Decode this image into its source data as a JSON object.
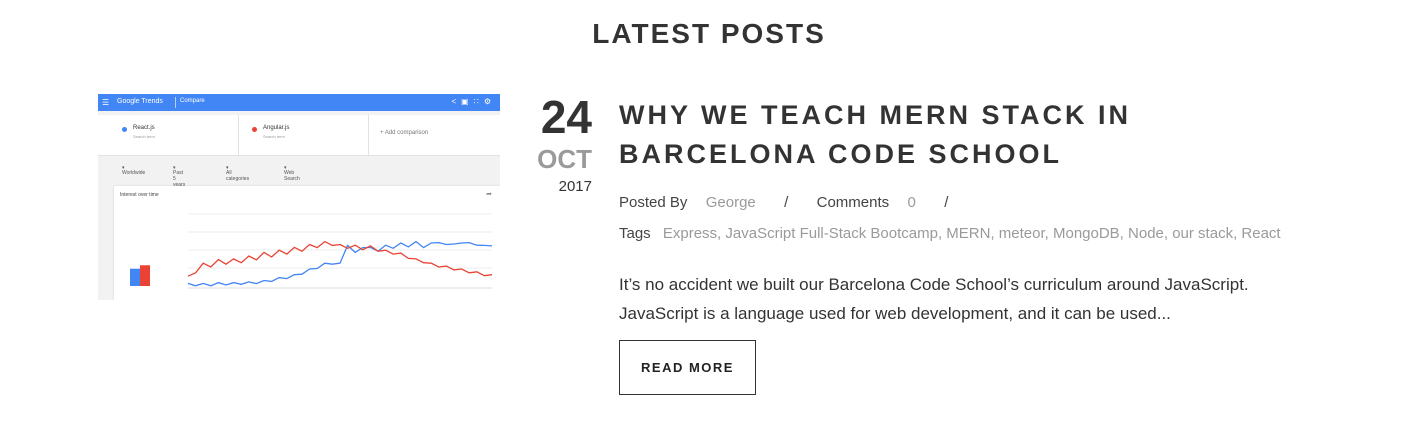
{
  "section": {
    "title": "LATEST POSTS"
  },
  "post": {
    "date": {
      "day": "24",
      "month": "OCT",
      "year": "2017"
    },
    "title": "WHY WE TEACH MERN STACK IN BARCELONA CODE SCHOOL",
    "meta": {
      "posted_by_label": "Posted By",
      "author": "George",
      "separator": "/",
      "comments_label": "Comments",
      "comments_count": "0"
    },
    "tags_label": "Tags",
    "tags": "Express, JavaScript Full-Stack Bootcamp, MERN, meteor, MongoDB, Node, our stack, React",
    "excerpt": "It’s no accident we built our Barcelona Code School’s curriculum around JavaScript. JavaScript is a language used for web development, and it can be used...",
    "read_more_label": "READ MORE"
  },
  "thumbnail": {
    "brand": "Google Trends",
    "page": "Compare",
    "icons": [
      "menu-icon",
      "share-icon",
      "feedback-icon",
      "apps-icon",
      "settings-icon"
    ],
    "terms": [
      {
        "name": "React.js",
        "sub": "Search term",
        "color": "#4285f4"
      },
      {
        "name": "Angular.js",
        "sub": "Search term",
        "color": "#ea4335"
      }
    ],
    "add_comparison": "Add comparison",
    "filters": [
      "Worldwide",
      "Past 5 years",
      "All categories",
      "Web Search"
    ],
    "card_title": "Interest over time",
    "chart_data": {
      "type": "line",
      "title": "Interest over time",
      "ylim": [
        0,
        100
      ],
      "series": [
        {
          "name": "React.js",
          "color": "#4285f4",
          "average": 15,
          "values": [
            2,
            2,
            2,
            2,
            3,
            3,
            3,
            4,
            4,
            5,
            6,
            8,
            10,
            12,
            14,
            18,
            22,
            26,
            30,
            32,
            30,
            58,
            45,
            55,
            52,
            50,
            55,
            54,
            58,
            56,
            60,
            55,
            58,
            62,
            56,
            60,
            58,
            62,
            55,
            58,
            54
          ]
        },
        {
          "name": "Angular.js",
          "color": "#ea4335",
          "average": 18,
          "values": [
            12,
            20,
            30,
            28,
            35,
            32,
            36,
            34,
            40,
            38,
            45,
            42,
            48,
            46,
            52,
            50,
            56,
            55,
            60,
            58,
            56,
            54,
            55,
            52,
            54,
            50,
            48,
            46,
            44,
            40,
            36,
            34,
            30,
            28,
            26,
            24,
            22,
            20,
            18,
            16,
            14
          ]
        }
      ],
      "grid": true
    }
  }
}
